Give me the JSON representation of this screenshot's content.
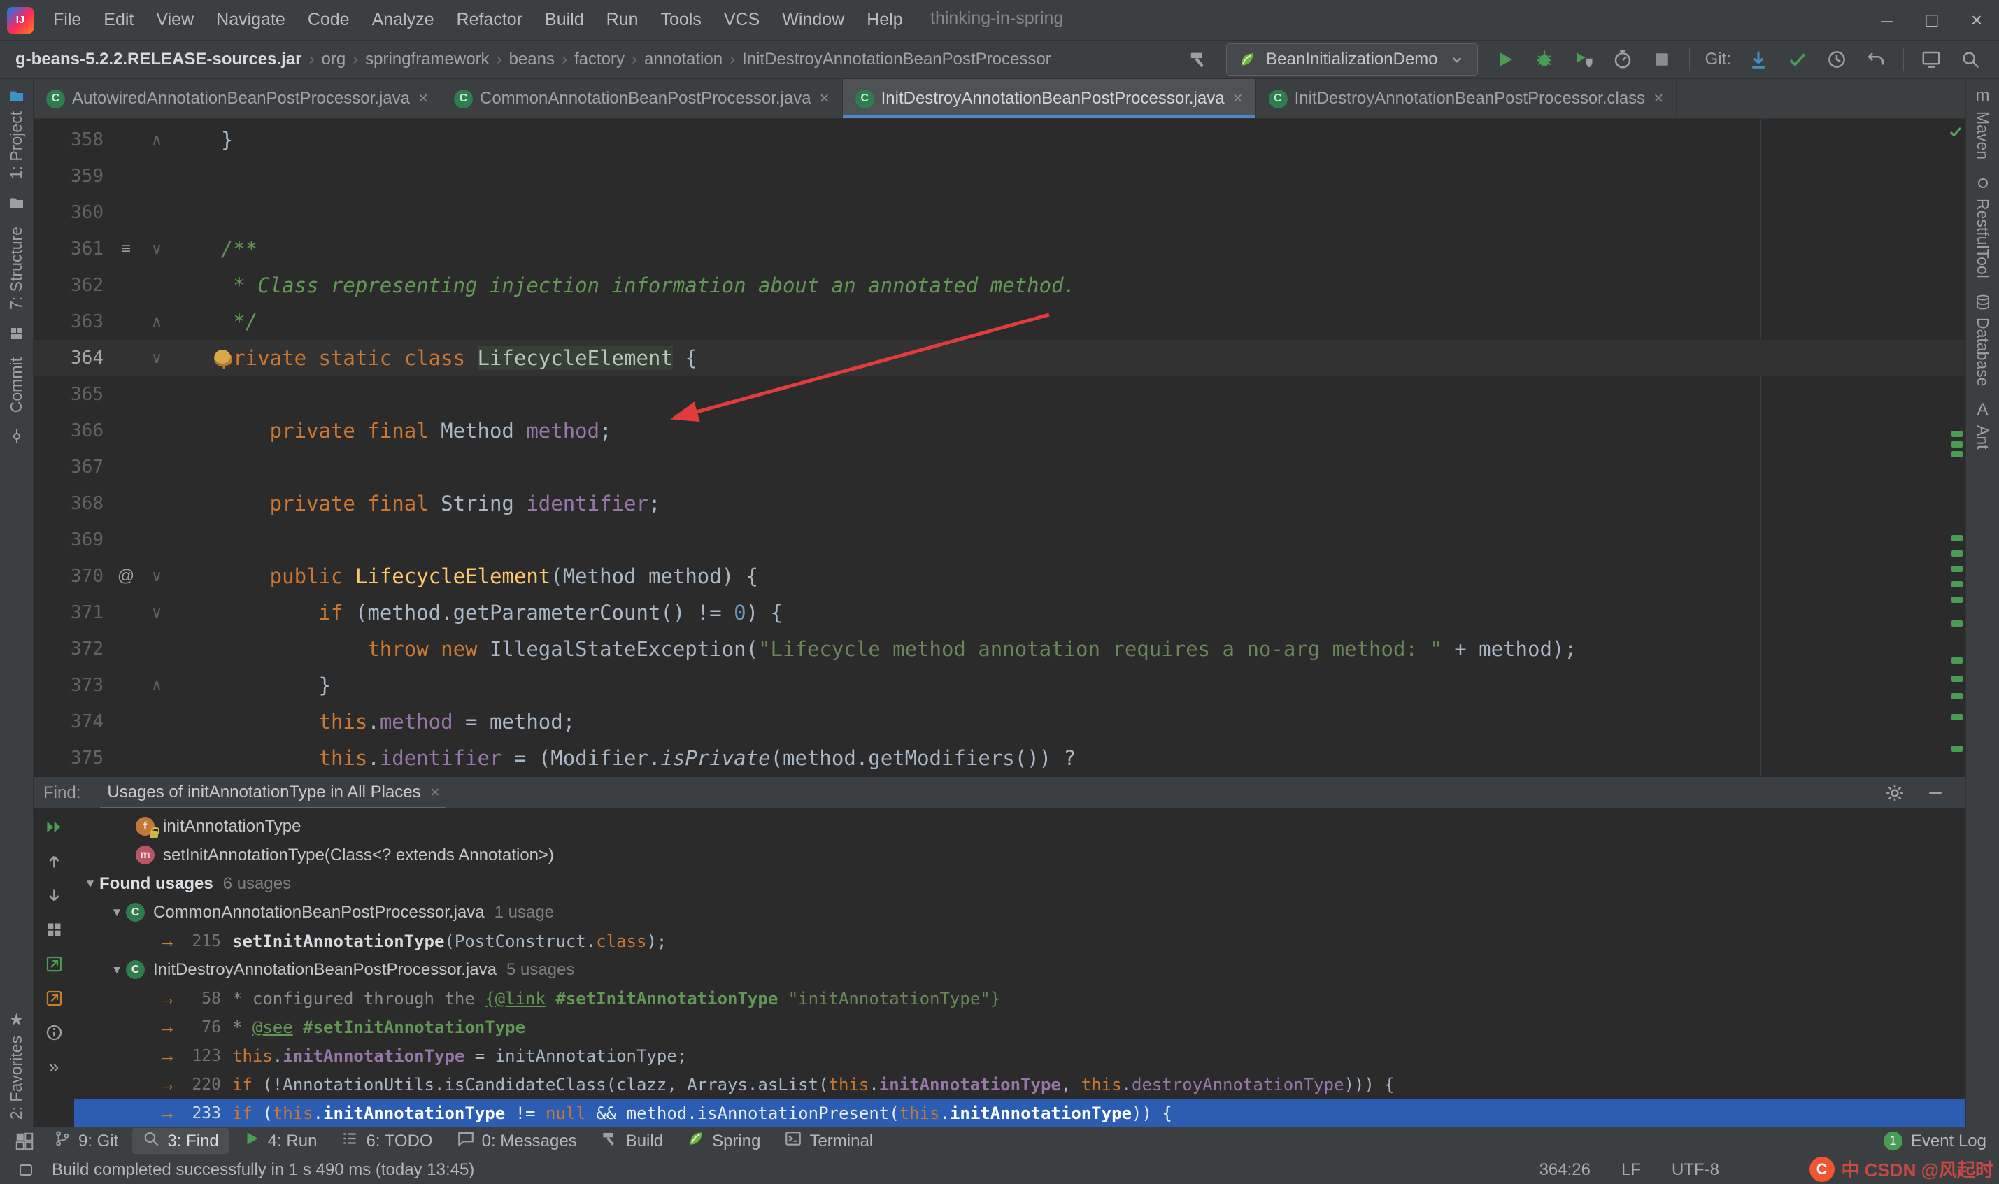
{
  "window": {
    "title": "thinking-in-spring",
    "menu": [
      "File",
      "Edit",
      "View",
      "Navigate",
      "Code",
      "Analyze",
      "Refactor",
      "Build",
      "Run",
      "Tools",
      "VCS",
      "Window",
      "Help"
    ],
    "controls": {
      "minimize": "–",
      "maximize": "□",
      "close": "×"
    }
  },
  "toolbar": {
    "breadcrumbs": [
      "g-beans-5.2.2.RELEASE-sources.jar",
      "org",
      "springframework",
      "beans",
      "factory",
      "annotation",
      "InitDestroyAnnotationBeanPostProcessor"
    ],
    "crumb_separator": "›",
    "run_config": "BeanInitializationDemo",
    "git_label": "Git:"
  },
  "icons": {
    "class_letter": "C",
    "field_letter": "f",
    "method_letter": "m",
    "expand_arrow": "▼",
    "usage_arrow": "→",
    "fold_start": "∨",
    "fold_end": "∧",
    "gutter_menu": "≡",
    "gutter_at": "@"
  },
  "tabs": [
    {
      "label": "AutowiredAnnotationBeanPostProcessor.java",
      "active": false
    },
    {
      "label": "CommonAnnotationBeanPostProcessor.java",
      "active": false
    },
    {
      "label": "InitDestroyAnnotationBeanPostProcessor.java",
      "active": true
    },
    {
      "label": "InitDestroyAnnotationBeanPostProcessor.class",
      "active": false
    }
  ],
  "editor": {
    "lines": [
      {
        "n": 358,
        "fold": "end",
        "segs": [
          [
            "plain",
            "    }"
          ]
        ]
      },
      {
        "n": 359,
        "segs": []
      },
      {
        "n": 360,
        "segs": []
      },
      {
        "n": 361,
        "gico": "menu",
        "fold": "start",
        "segs": [
          [
            "doc",
            "    /**"
          ]
        ]
      },
      {
        "n": 362,
        "segs": [
          [
            "doc",
            "     * Class representing injection information about an annotated method."
          ]
        ]
      },
      {
        "n": 363,
        "fold": "end",
        "segs": [
          [
            "doc",
            "     */"
          ]
        ]
      },
      {
        "n": 364,
        "fold": "start",
        "bulb": true,
        "caret": true,
        "segs": [
          [
            "kw",
            "    private static class "
          ],
          [
            "clsname",
            "LifecycleElement"
          ],
          [
            "plain",
            " {"
          ]
        ]
      },
      {
        "n": 365,
        "segs": []
      },
      {
        "n": 366,
        "segs": [
          [
            "kw",
            "        private final "
          ],
          [
            "plain",
            "Method "
          ],
          [
            "field",
            "method"
          ],
          [
            "plain",
            ";"
          ]
        ]
      },
      {
        "n": 367,
        "segs": []
      },
      {
        "n": 368,
        "segs": [
          [
            "kw",
            "        private final "
          ],
          [
            "plain",
            "String "
          ],
          [
            "field",
            "identifier"
          ],
          [
            "plain",
            ";"
          ]
        ]
      },
      {
        "n": 369,
        "segs": []
      },
      {
        "n": 370,
        "gico": "at",
        "fold": "start",
        "segs": [
          [
            "kw",
            "        public "
          ],
          [
            "decl",
            "LifecycleElement"
          ],
          [
            "plain",
            "(Method method) {"
          ]
        ]
      },
      {
        "n": 371,
        "fold": "start",
        "segs": [
          [
            "kw",
            "            if "
          ],
          [
            "plain",
            "(method.getParameterCount() != "
          ],
          [
            "num",
            "0"
          ],
          [
            "plain",
            ") {"
          ]
        ]
      },
      {
        "n": 372,
        "segs": [
          [
            "kw",
            "                throw new "
          ],
          [
            "plain",
            "IllegalStateException("
          ],
          [
            "str",
            "\"Lifecycle method annotation requires a no-arg method: \""
          ],
          [
            "plain",
            " + method);"
          ]
        ]
      },
      {
        "n": 373,
        "fold": "end",
        "segs": [
          [
            "plain",
            "            }"
          ]
        ]
      },
      {
        "n": 374,
        "segs": [
          [
            "kw",
            "            this"
          ],
          [
            "plain",
            "."
          ],
          [
            "field",
            "method"
          ],
          [
            "plain",
            " = method;"
          ]
        ]
      },
      {
        "n": 375,
        "segs": [
          [
            "kw",
            "            this"
          ],
          [
            "plain",
            "."
          ],
          [
            "field",
            "identifier"
          ],
          [
            "plain",
            " = (Modifier."
          ],
          [
            "italic",
            "isPrivate"
          ],
          [
            "plain",
            "(method.getModifiers()) ?"
          ]
        ]
      }
    ],
    "stripe_marks": [
      446,
      461,
      475,
      595,
      617,
      639,
      661,
      683,
      717,
      770,
      796,
      821,
      851,
      896
    ]
  },
  "find": {
    "label": "Find:",
    "tab": "Usages of initAnnotationType in All Places",
    "rows": [
      {
        "type": "target",
        "icon": "f",
        "lock": true,
        "label": "initAnnotationType"
      },
      {
        "type": "target",
        "icon": "m",
        "lock": false,
        "label": "setInitAnnotationType(Class<? extends Annotation>)"
      },
      {
        "type": "group",
        "title": "Found usages",
        "count": "6 usages"
      },
      {
        "type": "file",
        "name": "CommonAnnotationBeanPostProcessor.java",
        "count": "1 usage"
      },
      {
        "type": "usage",
        "line": "215",
        "segs": [
          [
            "bold",
            "setInitAnnotationType"
          ],
          [
            "plain",
            "(PostConstruct."
          ],
          [
            "kw",
            "class"
          ],
          [
            "plain",
            ");"
          ]
        ]
      },
      {
        "type": "file",
        "name": "InitDestroyAnnotationBeanPostProcessor.java",
        "count": "5 usages"
      },
      {
        "type": "usage",
        "line": "58",
        "segs": [
          [
            "gray",
            "* configured through the "
          ],
          [
            "doclink",
            "{@link"
          ],
          [
            "gray",
            " "
          ],
          [
            "docbold",
            "#setInitAnnotationType"
          ],
          [
            "docstr",
            " \"initAnnotationType\"}"
          ]
        ]
      },
      {
        "type": "usage",
        "line": "76",
        "segs": [
          [
            "gray",
            "* "
          ],
          [
            "doclink",
            "@see"
          ],
          [
            "gray",
            " "
          ],
          [
            "docbold",
            "#setInitAnnotationType"
          ]
        ]
      },
      {
        "type": "usage",
        "line": "123",
        "segs": [
          [
            "kw",
            "this"
          ],
          [
            "plain",
            "."
          ],
          [
            "fieldbold",
            "initAnnotationType"
          ],
          [
            "plain",
            " = initAnnotationType;"
          ]
        ]
      },
      {
        "type": "usage",
        "line": "220",
        "segs": [
          [
            "kw",
            "if"
          ],
          [
            "plain",
            " (!AnnotationUtils.isCandidateClass(clazz, Arrays.asList("
          ],
          [
            "kw",
            "this"
          ],
          [
            "plain",
            "."
          ],
          [
            "fieldbold",
            "initAnnotationType"
          ],
          [
            "plain",
            ", "
          ],
          [
            "kw",
            "this"
          ],
          [
            "plain",
            "."
          ],
          [
            "field",
            "destroyAnnotationType"
          ],
          [
            "plain",
            "))) {"
          ]
        ]
      },
      {
        "type": "usage",
        "line": "233",
        "selected": true,
        "segs": [
          [
            "kw",
            "if"
          ],
          [
            "sel",
            " ("
          ],
          [
            "kw",
            "this"
          ],
          [
            "sel",
            "."
          ],
          [
            "selbold",
            "initAnnotationType"
          ],
          [
            "sel",
            " != "
          ],
          [
            "kw",
            "null"
          ],
          [
            "sel",
            " && method.isAnnotationPresent("
          ],
          [
            "kw",
            "this"
          ],
          [
            "sel",
            "."
          ],
          [
            "selbold",
            "initAnnotationType"
          ],
          [
            "sel",
            ")) {"
          ]
        ]
      }
    ]
  },
  "bottombar": {
    "items": [
      {
        "icon": "branch",
        "label": "9: Git"
      },
      {
        "icon": "search",
        "label": "3: Find",
        "active": true
      },
      {
        "icon": "play",
        "label": "4: Run"
      },
      {
        "icon": "todo",
        "label": "6: TODO"
      },
      {
        "icon": "messages",
        "label": "0: Messages"
      },
      {
        "icon": "hammer",
        "label": "Build"
      },
      {
        "icon": "leaf",
        "label": "Spring"
      },
      {
        "icon": "terminal",
        "label": "Terminal"
      }
    ],
    "event_log": {
      "badge": "1",
      "label": "Event Log"
    }
  },
  "status": {
    "message": "Build completed successfully in 1 s 490 ms (today 13:45)",
    "caret": "364:26",
    "line_ending": "LF",
    "encoding": "UTF-8",
    "watermark": "中 CSDN @风起时"
  },
  "stripes": {
    "left_top": [
      {
        "icon": "project",
        "label": "1: Project"
      },
      {
        "icon": "folder",
        "label": ""
      },
      {
        "icon": "",
        "label": "7: Structure"
      },
      {
        "icon": "grid",
        "label": ""
      },
      {
        "icon": "",
        "label": "Commit"
      },
      {
        "icon": "commitnode",
        "label": ""
      }
    ],
    "left_bottom": [
      {
        "icon": "star",
        "label": "2: Favorites"
      }
    ],
    "right_top": [
      {
        "icon": "maven",
        "label": "Maven"
      },
      {
        "icon": "dot",
        "label": "RestfulTool"
      },
      {
        "icon": "db",
        "label": "Database"
      },
      {
        "icon": "ant",
        "label": "Ant"
      }
    ]
  },
  "colors": {
    "accent_blue": "#4a88c7",
    "keyword_orange": "#cc7832",
    "string_green": "#6a8759",
    "field_purple": "#9876aa",
    "selection_blue": "#2b5eb2",
    "run_green": "#499c54",
    "editor_bg": "#2b2b2b",
    "panel_bg": "#3c3f41",
    "arrow_red": "#e13c3c"
  }
}
